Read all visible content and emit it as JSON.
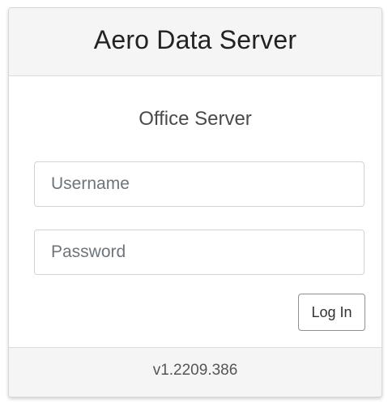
{
  "header": {
    "title": "Aero Data Server"
  },
  "login": {
    "subtitle": "Office Server",
    "username_placeholder": "Username",
    "username_value": "",
    "password_placeholder": "Password",
    "password_value": "",
    "submit_label": "Log In"
  },
  "footer": {
    "version": "v1.2209.386"
  }
}
